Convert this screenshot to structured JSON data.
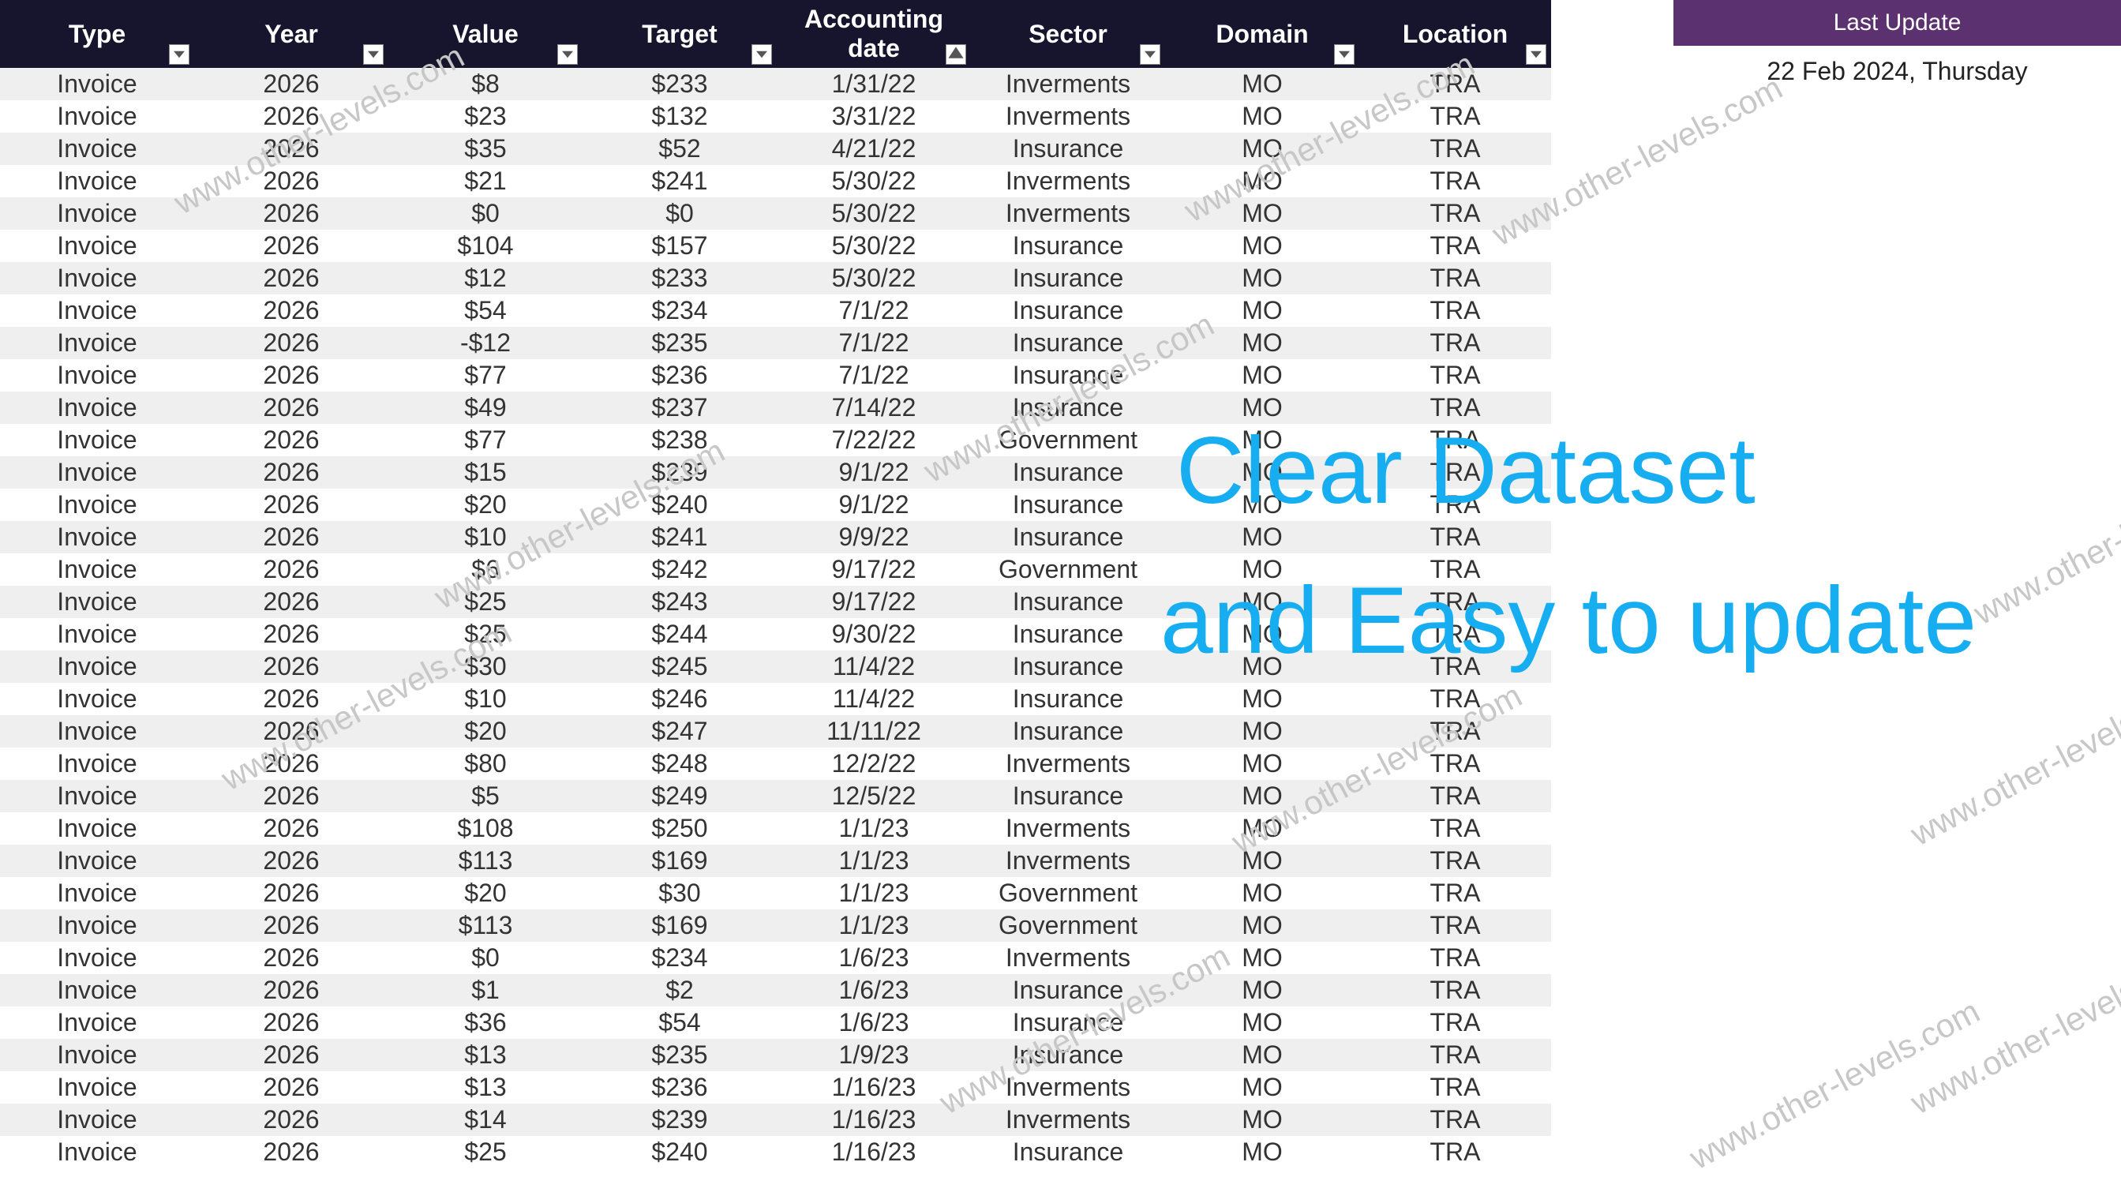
{
  "headers": [
    "Type",
    "Year",
    "Value",
    "Target",
    "Accounting date",
    "Sector",
    "Domain",
    "Location"
  ],
  "rows": [
    {
      "type": "Invoice",
      "year": "2026",
      "value": "$8",
      "target": "$233",
      "date": "1/31/22",
      "sector": "Inverments",
      "domain": "MO",
      "location": "TRA"
    },
    {
      "type": "Invoice",
      "year": "2026",
      "value": "$23",
      "target": "$132",
      "date": "3/31/22",
      "sector": "Inverments",
      "domain": "MO",
      "location": "TRA"
    },
    {
      "type": "Invoice",
      "year": "2026",
      "value": "$35",
      "target": "$52",
      "date": "4/21/22",
      "sector": "Insurance",
      "domain": "MO",
      "location": "TRA"
    },
    {
      "type": "Invoice",
      "year": "2026",
      "value": "$21",
      "target": "$241",
      "date": "5/30/22",
      "sector": "Inverments",
      "domain": "MO",
      "location": "TRA"
    },
    {
      "type": "Invoice",
      "year": "2026",
      "value": "$0",
      "target": "$0",
      "date": "5/30/22",
      "sector": "Inverments",
      "domain": "MO",
      "location": "TRA"
    },
    {
      "type": "Invoice",
      "year": "2026",
      "value": "$104",
      "target": "$157",
      "date": "5/30/22",
      "sector": "Insurance",
      "domain": "MO",
      "location": "TRA"
    },
    {
      "type": "Invoice",
      "year": "2026",
      "value": "$12",
      "target": "$233",
      "date": "5/30/22",
      "sector": "Insurance",
      "domain": "MO",
      "location": "TRA"
    },
    {
      "type": "Invoice",
      "year": "2026",
      "value": "$54",
      "target": "$234",
      "date": "7/1/22",
      "sector": "Insurance",
      "domain": "MO",
      "location": "TRA"
    },
    {
      "type": "Invoice",
      "year": "2026",
      "value": "-$12",
      "target": "$235",
      "date": "7/1/22",
      "sector": "Insurance",
      "domain": "MO",
      "location": "TRA"
    },
    {
      "type": "Invoice",
      "year": "2026",
      "value": "$77",
      "target": "$236",
      "date": "7/1/22",
      "sector": "Insurance",
      "domain": "MO",
      "location": "TRA"
    },
    {
      "type": "Invoice",
      "year": "2026",
      "value": "$49",
      "target": "$237",
      "date": "7/14/22",
      "sector": "Insurance",
      "domain": "MO",
      "location": "TRA"
    },
    {
      "type": "Invoice",
      "year": "2026",
      "value": "$77",
      "target": "$238",
      "date": "7/22/22",
      "sector": "Government",
      "domain": "MO",
      "location": "TRA"
    },
    {
      "type": "Invoice",
      "year": "2026",
      "value": "$15",
      "target": "$239",
      "date": "9/1/22",
      "sector": "Insurance",
      "domain": "MO",
      "location": "TRA"
    },
    {
      "type": "Invoice",
      "year": "2026",
      "value": "$20",
      "target": "$240",
      "date": "9/1/22",
      "sector": "Insurance",
      "domain": "MO",
      "location": "TRA"
    },
    {
      "type": "Invoice",
      "year": "2026",
      "value": "$10",
      "target": "$241",
      "date": "9/9/22",
      "sector": "Insurance",
      "domain": "MO",
      "location": "TRA"
    },
    {
      "type": "Invoice",
      "year": "2026",
      "value": "$6",
      "target": "$242",
      "date": "9/17/22",
      "sector": "Government",
      "domain": "MO",
      "location": "TRA"
    },
    {
      "type": "Invoice",
      "year": "2026",
      "value": "$25",
      "target": "$243",
      "date": "9/17/22",
      "sector": "Insurance",
      "domain": "MO",
      "location": "TRA"
    },
    {
      "type": "Invoice",
      "year": "2026",
      "value": "$25",
      "target": "$244",
      "date": "9/30/22",
      "sector": "Insurance",
      "domain": "MO",
      "location": "TRA"
    },
    {
      "type": "Invoice",
      "year": "2026",
      "value": "$30",
      "target": "$245",
      "date": "11/4/22",
      "sector": "Insurance",
      "domain": "MO",
      "location": "TRA"
    },
    {
      "type": "Invoice",
      "year": "2026",
      "value": "$10",
      "target": "$246",
      "date": "11/4/22",
      "sector": "Insurance",
      "domain": "MO",
      "location": "TRA"
    },
    {
      "type": "Invoice",
      "year": "2026",
      "value": "$20",
      "target": "$247",
      "date": "11/11/22",
      "sector": "Insurance",
      "domain": "MO",
      "location": "TRA"
    },
    {
      "type": "Invoice",
      "year": "2026",
      "value": "$80",
      "target": "$248",
      "date": "12/2/22",
      "sector": "Inverments",
      "domain": "MO",
      "location": "TRA"
    },
    {
      "type": "Invoice",
      "year": "2026",
      "value": "$5",
      "target": "$249",
      "date": "12/5/22",
      "sector": "Insurance",
      "domain": "MO",
      "location": "TRA"
    },
    {
      "type": "Invoice",
      "year": "2026",
      "value": "$108",
      "target": "$250",
      "date": "1/1/23",
      "sector": "Inverments",
      "domain": "MO",
      "location": "TRA"
    },
    {
      "type": "Invoice",
      "year": "2026",
      "value": "$113",
      "target": "$169",
      "date": "1/1/23",
      "sector": "Inverments",
      "domain": "MO",
      "location": "TRA"
    },
    {
      "type": "Invoice",
      "year": "2026",
      "value": "$20",
      "target": "$30",
      "date": "1/1/23",
      "sector": "Government",
      "domain": "MO",
      "location": "TRA"
    },
    {
      "type": "Invoice",
      "year": "2026",
      "value": "$113",
      "target": "$169",
      "date": "1/1/23",
      "sector": "Government",
      "domain": "MO",
      "location": "TRA"
    },
    {
      "type": "Invoice",
      "year": "2026",
      "value": "$0",
      "target": "$234",
      "date": "1/6/23",
      "sector": "Inverments",
      "domain": "MO",
      "location": "TRA"
    },
    {
      "type": "Invoice",
      "year": "2026",
      "value": "$1",
      "target": "$2",
      "date": "1/6/23",
      "sector": "Insurance",
      "domain": "MO",
      "location": "TRA"
    },
    {
      "type": "Invoice",
      "year": "2026",
      "value": "$36",
      "target": "$54",
      "date": "1/6/23",
      "sector": "Insurance",
      "domain": "MO",
      "location": "TRA"
    },
    {
      "type": "Invoice",
      "year": "2026",
      "value": "$13",
      "target": "$235",
      "date": "1/9/23",
      "sector": "Insurance",
      "domain": "MO",
      "location": "TRA"
    },
    {
      "type": "Invoice",
      "year": "2026",
      "value": "$13",
      "target": "$236",
      "date": "1/16/23",
      "sector": "Inverments",
      "domain": "MO",
      "location": "TRA"
    },
    {
      "type": "Invoice",
      "year": "2026",
      "value": "$14",
      "target": "$239",
      "date": "1/16/23",
      "sector": "Inverments",
      "domain": "MO",
      "location": "TRA"
    },
    {
      "type": "Invoice",
      "year": "2026",
      "value": "$25",
      "target": "$240",
      "date": "1/16/23",
      "sector": "Insurance",
      "domain": "MO",
      "location": "TRA"
    }
  ],
  "side": {
    "update_label": "Last Update",
    "update_date": "22 Feb 2024, Thursday"
  },
  "watermark_text": "www.other-levels.com",
  "overlay": {
    "line1": "Clear Dataset",
    "line2": "and Easy to update"
  }
}
